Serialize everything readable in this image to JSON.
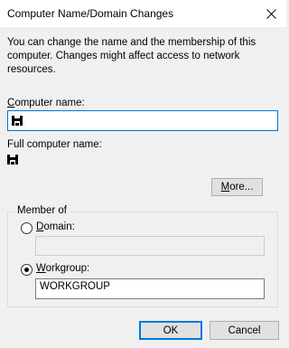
{
  "window": {
    "title": "Computer Name/Domain Changes"
  },
  "description": "You can change the name and the membership of this computer. Changes might affect access to network resources.",
  "computer_name": {
    "label": "Computer name:",
    "value": ""
  },
  "full_computer_name": {
    "label": "Full computer name:",
    "value": ""
  },
  "more_button": {
    "label": "More..."
  },
  "member_of": {
    "legend": "Member of",
    "domain": {
      "label": "Domain:",
      "selected": false,
      "value": ""
    },
    "workgroup": {
      "label": "Workgroup:",
      "selected": true,
      "value": "WORKGROUP"
    }
  },
  "buttons": {
    "ok": "OK",
    "cancel": "Cancel"
  },
  "icons": {
    "close": "close-icon",
    "computer": "computer-icon"
  },
  "colors": {
    "focus_accent": "#0078d7"
  }
}
